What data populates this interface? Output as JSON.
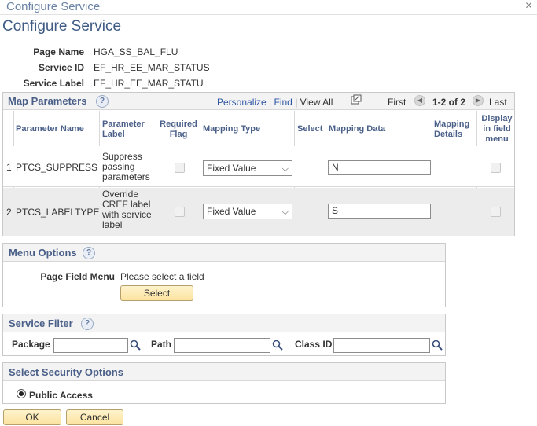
{
  "window": {
    "title": "Configure Service"
  },
  "page_title": "Configure Service",
  "info": {
    "page_name_label": "Page Name",
    "page_name_value": "HGA_SS_BAL_FLU",
    "service_id_label": "Service ID",
    "service_id_value": "EF_HR_EE_MAR_STATUS",
    "service_label_label": "Service Label",
    "service_label_value": "EF_HR_EE_MAR_STATU"
  },
  "map_parameters": {
    "title": "Map Parameters",
    "nav": {
      "personalize": "Personalize",
      "find": "Find",
      "view_all": "View All",
      "first": "First",
      "range": "1-2 of 2",
      "last": "Last"
    },
    "columns": {
      "parameter_name": "Parameter Name",
      "parameter_label": "Parameter Label",
      "required_flag": "Required Flag",
      "mapping_type": "Mapping Type",
      "select": "Select",
      "mapping_data": "Mapping Data",
      "mapping_details": "Mapping Details",
      "display_in_field_menu": "Display in field menu"
    },
    "rows": [
      {
        "num": "1",
        "name": "PTCS_SUPPRESS",
        "label": "Suppress passing parameters",
        "mapping_type": "Fixed Value",
        "mapping_data": "N"
      },
      {
        "num": "2",
        "name": "PTCS_LABELTYPE",
        "label": "Override CREF label with service label",
        "mapping_type": "Fixed Value",
        "mapping_data": "S"
      }
    ]
  },
  "menu_options": {
    "title": "Menu Options",
    "page_field_menu_label": "Page Field Menu",
    "page_field_menu_value": "Please select a field",
    "select_button": "Select"
  },
  "service_filter": {
    "title": "Service Filter",
    "package_label": "Package",
    "package_value": "",
    "path_label": "Path",
    "path_value": "",
    "class_id_label": "Class ID",
    "class_id_value": ""
  },
  "security": {
    "title": "Select Security Options",
    "public_access": "Public Access"
  },
  "buttons": {
    "ok": "OK",
    "cancel": "Cancel"
  },
  "colors": {
    "accent": "#3f5b85",
    "header_text": "#4b6089",
    "link": "#2e56a4",
    "button_fill": "#fbe3a0",
    "alt_row": "#ececec"
  }
}
